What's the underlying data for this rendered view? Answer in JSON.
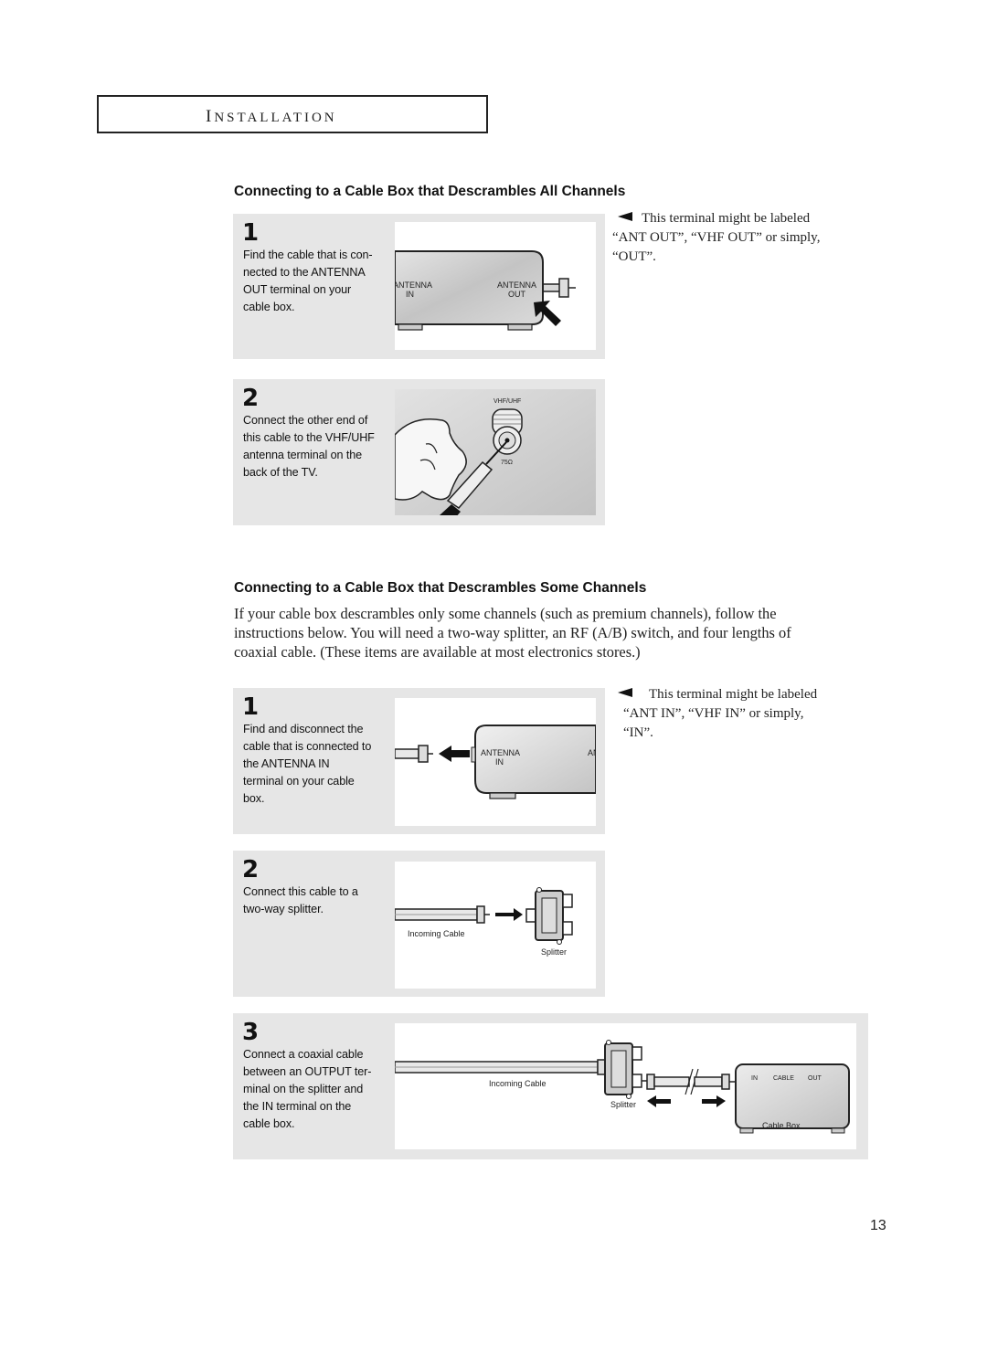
{
  "header": {
    "section_title_first": "I",
    "section_title_rest": "NSTALLATION"
  },
  "section1": {
    "heading": "Connecting to a Cable Box that Descrambles All Channels",
    "note": {
      "icon": "left-pointer-icon",
      "text_line1": "This terminal might be labeled",
      "text_line2": "“ANT OUT”, “VHF OUT” or simply,",
      "text_line3": "“OUT”."
    },
    "steps": [
      {
        "number": "1",
        "text": "Find the cable that is con- nected to the ANTENNA OUT terminal on your cable box.",
        "lines": [
          "Find the cable that is con-",
          "nected to the ANTENNA",
          "OUT terminal on your",
          "cable box."
        ],
        "figure": {
          "label_in_1": "ANTENNA",
          "label_in_2": "IN",
          "label_out_1": "ANTENNA",
          "label_out_2": "OUT"
        }
      },
      {
        "number": "2",
        "text": "Connect the other end of this cable to the VHF/UHF antenna terminal on the back of the TV.",
        "lines": [
          "Connect the other end of",
          "this cable to the VHF/UHF",
          "antenna terminal on the",
          "back of the TV."
        ],
        "figure": {
          "terminal_label": "VHF/UHF",
          "impedance_label": "75Ω"
        }
      }
    ]
  },
  "section2": {
    "heading": "Connecting to a Cable Box that Descrambles Some Channels",
    "intro_line1": "If your cable box descrambles only some channels (such as premium channels), follow the",
    "intro_line2": "instructions below. You will need a two-way splitter, an RF (A/B) switch, and four lengths of",
    "intro_line3": "coaxial cable. (These items are available at most electronics stores.)",
    "note": {
      "icon": "left-pointer-icon",
      "text_line1": "This terminal might be labeled",
      "text_line2": "“ANT IN”, “VHF IN” or simply,",
      "text_line3": "“IN”."
    },
    "steps": [
      {
        "number": "1",
        "lines": [
          "Find and disconnect the",
          "cable that is connected to",
          "the ANTENNA IN",
          "terminal on your cable",
          "box."
        ],
        "figure": {
          "label_in_1": "ANTENNA",
          "label_in_2": "IN",
          "label_cut": "AN"
        }
      },
      {
        "number": "2",
        "lines": [
          "Connect this cable to a",
          "two-way splitter."
        ],
        "figure": {
          "cable_label": "Incoming Cable",
          "splitter_label": "Splitter"
        }
      },
      {
        "number": "3",
        "lines": [
          "Connect a coaxial cable",
          "between an OUTPUT ter-",
          "minal on the splitter and",
          "the IN terminal on the",
          "cable box."
        ],
        "figure": {
          "cable_label": "Incoming Cable",
          "splitter_label": "Splitter",
          "box_label": "Cable Box",
          "box_in": "IN",
          "box_cable": "CABLE",
          "box_out": "OUT"
        }
      }
    ]
  },
  "footer": {
    "page_number": "13"
  }
}
